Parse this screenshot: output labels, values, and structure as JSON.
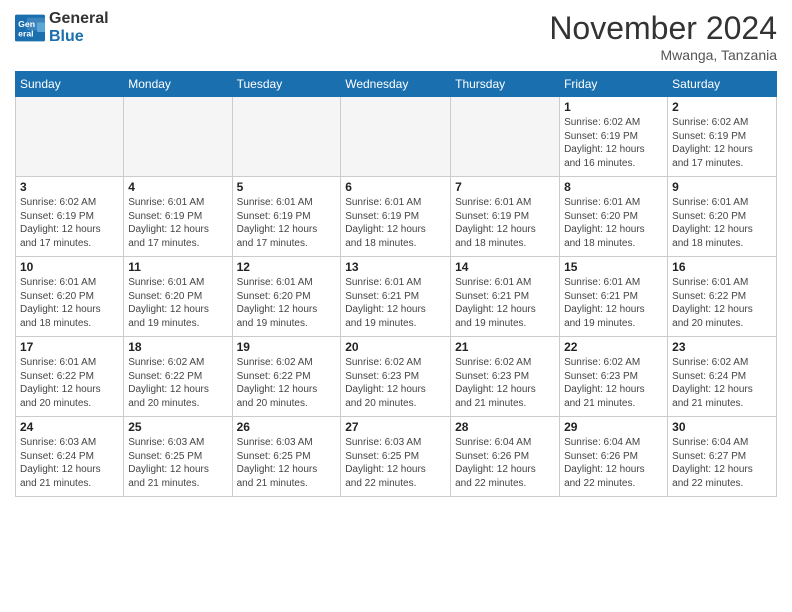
{
  "logo": {
    "text_general": "General",
    "text_blue": "Blue"
  },
  "title": "November 2024",
  "location": "Mwanga, Tanzania",
  "days_of_week": [
    "Sunday",
    "Monday",
    "Tuesday",
    "Wednesday",
    "Thursday",
    "Friday",
    "Saturday"
  ],
  "weeks": [
    [
      {
        "day": "",
        "info": ""
      },
      {
        "day": "",
        "info": ""
      },
      {
        "day": "",
        "info": ""
      },
      {
        "day": "",
        "info": ""
      },
      {
        "day": "",
        "info": ""
      },
      {
        "day": "1",
        "info": "Sunrise: 6:02 AM\nSunset: 6:19 PM\nDaylight: 12 hours\nand 16 minutes."
      },
      {
        "day": "2",
        "info": "Sunrise: 6:02 AM\nSunset: 6:19 PM\nDaylight: 12 hours\nand 17 minutes."
      }
    ],
    [
      {
        "day": "3",
        "info": "Sunrise: 6:02 AM\nSunset: 6:19 PM\nDaylight: 12 hours\nand 17 minutes."
      },
      {
        "day": "4",
        "info": "Sunrise: 6:01 AM\nSunset: 6:19 PM\nDaylight: 12 hours\nand 17 minutes."
      },
      {
        "day": "5",
        "info": "Sunrise: 6:01 AM\nSunset: 6:19 PM\nDaylight: 12 hours\nand 17 minutes."
      },
      {
        "day": "6",
        "info": "Sunrise: 6:01 AM\nSunset: 6:19 PM\nDaylight: 12 hours\nand 18 minutes."
      },
      {
        "day": "7",
        "info": "Sunrise: 6:01 AM\nSunset: 6:19 PM\nDaylight: 12 hours\nand 18 minutes."
      },
      {
        "day": "8",
        "info": "Sunrise: 6:01 AM\nSunset: 6:20 PM\nDaylight: 12 hours\nand 18 minutes."
      },
      {
        "day": "9",
        "info": "Sunrise: 6:01 AM\nSunset: 6:20 PM\nDaylight: 12 hours\nand 18 minutes."
      }
    ],
    [
      {
        "day": "10",
        "info": "Sunrise: 6:01 AM\nSunset: 6:20 PM\nDaylight: 12 hours\nand 18 minutes."
      },
      {
        "day": "11",
        "info": "Sunrise: 6:01 AM\nSunset: 6:20 PM\nDaylight: 12 hours\nand 19 minutes."
      },
      {
        "day": "12",
        "info": "Sunrise: 6:01 AM\nSunset: 6:20 PM\nDaylight: 12 hours\nand 19 minutes."
      },
      {
        "day": "13",
        "info": "Sunrise: 6:01 AM\nSunset: 6:21 PM\nDaylight: 12 hours\nand 19 minutes."
      },
      {
        "day": "14",
        "info": "Sunrise: 6:01 AM\nSunset: 6:21 PM\nDaylight: 12 hours\nand 19 minutes."
      },
      {
        "day": "15",
        "info": "Sunrise: 6:01 AM\nSunset: 6:21 PM\nDaylight: 12 hours\nand 19 minutes."
      },
      {
        "day": "16",
        "info": "Sunrise: 6:01 AM\nSunset: 6:22 PM\nDaylight: 12 hours\nand 20 minutes."
      }
    ],
    [
      {
        "day": "17",
        "info": "Sunrise: 6:01 AM\nSunset: 6:22 PM\nDaylight: 12 hours\nand 20 minutes."
      },
      {
        "day": "18",
        "info": "Sunrise: 6:02 AM\nSunset: 6:22 PM\nDaylight: 12 hours\nand 20 minutes."
      },
      {
        "day": "19",
        "info": "Sunrise: 6:02 AM\nSunset: 6:22 PM\nDaylight: 12 hours\nand 20 minutes."
      },
      {
        "day": "20",
        "info": "Sunrise: 6:02 AM\nSunset: 6:23 PM\nDaylight: 12 hours\nand 20 minutes."
      },
      {
        "day": "21",
        "info": "Sunrise: 6:02 AM\nSunset: 6:23 PM\nDaylight: 12 hours\nand 21 minutes."
      },
      {
        "day": "22",
        "info": "Sunrise: 6:02 AM\nSunset: 6:23 PM\nDaylight: 12 hours\nand 21 minutes."
      },
      {
        "day": "23",
        "info": "Sunrise: 6:02 AM\nSunset: 6:24 PM\nDaylight: 12 hours\nand 21 minutes."
      }
    ],
    [
      {
        "day": "24",
        "info": "Sunrise: 6:03 AM\nSunset: 6:24 PM\nDaylight: 12 hours\nand 21 minutes."
      },
      {
        "day": "25",
        "info": "Sunrise: 6:03 AM\nSunset: 6:25 PM\nDaylight: 12 hours\nand 21 minutes."
      },
      {
        "day": "26",
        "info": "Sunrise: 6:03 AM\nSunset: 6:25 PM\nDaylight: 12 hours\nand 21 minutes."
      },
      {
        "day": "27",
        "info": "Sunrise: 6:03 AM\nSunset: 6:25 PM\nDaylight: 12 hours\nand 22 minutes."
      },
      {
        "day": "28",
        "info": "Sunrise: 6:04 AM\nSunset: 6:26 PM\nDaylight: 12 hours\nand 22 minutes."
      },
      {
        "day": "29",
        "info": "Sunrise: 6:04 AM\nSunset: 6:26 PM\nDaylight: 12 hours\nand 22 minutes."
      },
      {
        "day": "30",
        "info": "Sunrise: 6:04 AM\nSunset: 6:27 PM\nDaylight: 12 hours\nand 22 minutes."
      }
    ]
  ]
}
